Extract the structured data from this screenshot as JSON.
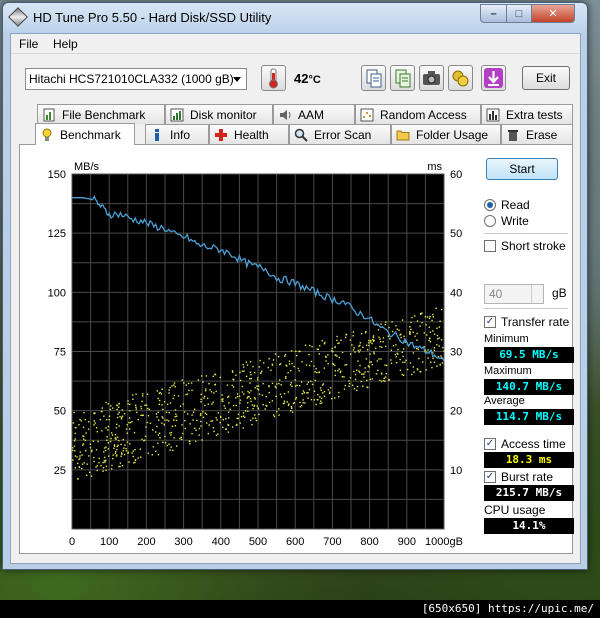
{
  "window": {
    "title": "HD Tune Pro 5.50 - Hard Disk/SSD Utility",
    "min_glyph": "–",
    "max_glyph": "□",
    "close_glyph": "✕"
  },
  "menu": {
    "file": "File",
    "help": "Help"
  },
  "toolbar": {
    "drive": "Hitachi HCS721010CLA332 (1000 gB)",
    "temperature": "42",
    "temperature_unit": "°C",
    "exit_label": "Exit"
  },
  "tabs_top": [
    {
      "label": "File Benchmark"
    },
    {
      "label": "Disk monitor"
    },
    {
      "label": "AAM"
    },
    {
      "label": "Random Access"
    },
    {
      "label": "Extra tests"
    }
  ],
  "tabs_bottom": [
    {
      "label": "Benchmark"
    },
    {
      "label": "Info"
    },
    {
      "label": "Health"
    },
    {
      "label": "Error Scan"
    },
    {
      "label": "Folder Usage"
    },
    {
      "label": "Erase"
    }
  ],
  "controls": {
    "start_label": "Start",
    "read_label": "Read",
    "write_label": "Write",
    "short_stroke_label": "Short stroke",
    "short_stroke_value": "40",
    "short_stroke_unit": "gB",
    "transfer_rate_label": "Transfer rate",
    "access_time_label": "Access time",
    "burst_rate_label": "Burst rate",
    "cpu_usage_label": "CPU usage"
  },
  "stats": {
    "minimum_label": "Minimum",
    "minimum": "69.5 MB/s",
    "maximum_label": "Maximum",
    "maximum": "140.7 MB/s",
    "average_label": "Average",
    "average": "114.7 MB/s",
    "access_time": "18.3 ms",
    "burst_rate": "215.7 MB/s",
    "cpu_usage": "14.1%"
  },
  "colors": {
    "stat_text": "#00ffff",
    "access_text": "#ffff00",
    "burst_text": "#ffffff",
    "cpu_text": "#ffffff",
    "line": "#4a9fd4",
    "dots": "#e8e84a"
  },
  "chart_data": {
    "type": "line",
    "y_left_label": "MB/s",
    "y_right_label": "ms",
    "x_unit": "gB",
    "x_ticks": [
      0,
      100,
      200,
      300,
      400,
      500,
      600,
      700,
      800,
      900,
      1000
    ],
    "y_left_ticks": [
      25,
      50,
      75,
      100,
      125,
      150
    ],
    "y_right_ticks": [
      10,
      20,
      30,
      40,
      50,
      60
    ],
    "xlim": [
      0,
      1000
    ],
    "ylim_left": [
      0,
      150
    ],
    "ylim_right": [
      0,
      60
    ],
    "grid": true,
    "series": [
      {
        "axis": "left",
        "x": [
          0,
          30,
          60,
          80,
          100,
          130,
          160,
          190,
          220,
          250,
          280,
          310,
          340,
          370,
          400,
          430,
          460,
          490,
          520,
          550,
          580,
          610,
          640,
          670,
          700,
          730,
          760,
          790,
          820,
          850,
          880,
          910,
          940,
          970,
          1000
        ],
        "y": [
          140,
          140,
          139,
          136,
          133,
          133,
          131,
          130,
          128,
          127,
          124,
          123,
          120,
          119,
          118,
          116,
          113,
          111,
          110,
          106,
          105,
          103,
          101,
          99,
          97,
          96,
          92,
          90,
          86,
          83,
          81,
          78,
          76,
          74,
          71
        ]
      },
      {
        "axis": "right",
        "type": "scatter",
        "x_range": [
          0,
          1000
        ],
        "y_range_start": [
          8,
          20
        ],
        "y_range_end": [
          28,
          38
        ]
      }
    ]
  }
}
